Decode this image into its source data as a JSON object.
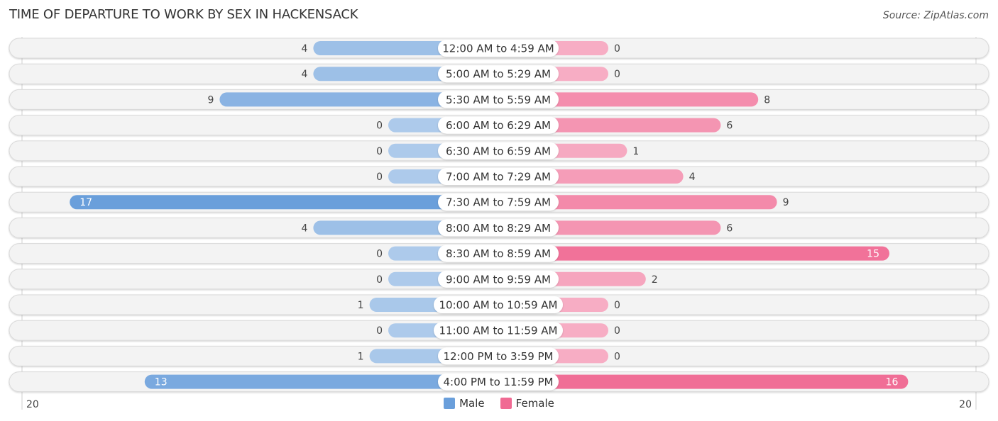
{
  "title": "TIME OF DEPARTURE TO WORK BY SEX IN HACKENSACK",
  "source": "Source: ZipAtlas.com",
  "legend": [
    {
      "label": "Male",
      "color": "#6a9fdb"
    },
    {
      "label": "Female",
      "color": "#f06a93"
    }
  ],
  "chart_data": {
    "type": "bar",
    "orientation": "horizontal-diverging",
    "title": "TIME OF DEPARTURE TO WORK BY SEX IN HACKENSACK",
    "categories": [
      "12:00 AM to 4:59 AM",
      "5:00 AM to 5:29 AM",
      "5:30 AM to 5:59 AM",
      "6:00 AM to 6:29 AM",
      "6:30 AM to 6:59 AM",
      "7:00 AM to 7:29 AM",
      "7:30 AM to 7:59 AM",
      "8:00 AM to 8:29 AM",
      "8:30 AM to 8:59 AM",
      "9:00 AM to 9:59 AM",
      "10:00 AM to 10:59 AM",
      "11:00 AM to 11:59 AM",
      "12:00 PM to 3:59 PM",
      "4:00 PM to 11:59 PM"
    ],
    "series": [
      {
        "name": "Male",
        "color": "#6a9fdb",
        "values": [
          4,
          4,
          9,
          0,
          0,
          0,
          17,
          4,
          0,
          0,
          1,
          0,
          1,
          13
        ]
      },
      {
        "name": "Female",
        "color": "#f06a93",
        "values": [
          0,
          0,
          8,
          6,
          1,
          4,
          9,
          6,
          15,
          2,
          0,
          0,
          0,
          16
        ]
      }
    ],
    "axis": {
      "left_tick": "20",
      "right_tick": "20",
      "max": 20
    },
    "legend_position": "bottom-center"
  }
}
